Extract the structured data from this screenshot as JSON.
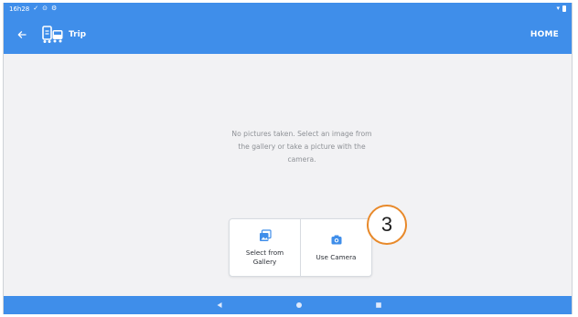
{
  "status_bar": {
    "time": "16h28",
    "icons_left": [
      "check-icon",
      "cast-icon",
      "settings-icon"
    ],
    "icons_right": [
      "wifi-icon",
      "battery-icon"
    ]
  },
  "app_bar": {
    "title": "Trip",
    "home_label": "HOME",
    "icons": [
      "back-arrow-icon",
      "trip-icon"
    ]
  },
  "content": {
    "empty_message": "No pictures taken. Select an image from the gallery or take a picture with the camera.",
    "actions": [
      {
        "label": "Select from Gallery",
        "icon": "gallery-icon"
      },
      {
        "label": "Use Camera",
        "icon": "camera-icon"
      }
    ],
    "step_badge": "3"
  },
  "nav_bar": {
    "buttons": [
      "back-triangle-icon",
      "home-circle-icon",
      "recents-square-icon"
    ]
  },
  "colors": {
    "primary": "#3f8eea",
    "badge_border": "#e8892a",
    "background": "#f2f2f4"
  }
}
